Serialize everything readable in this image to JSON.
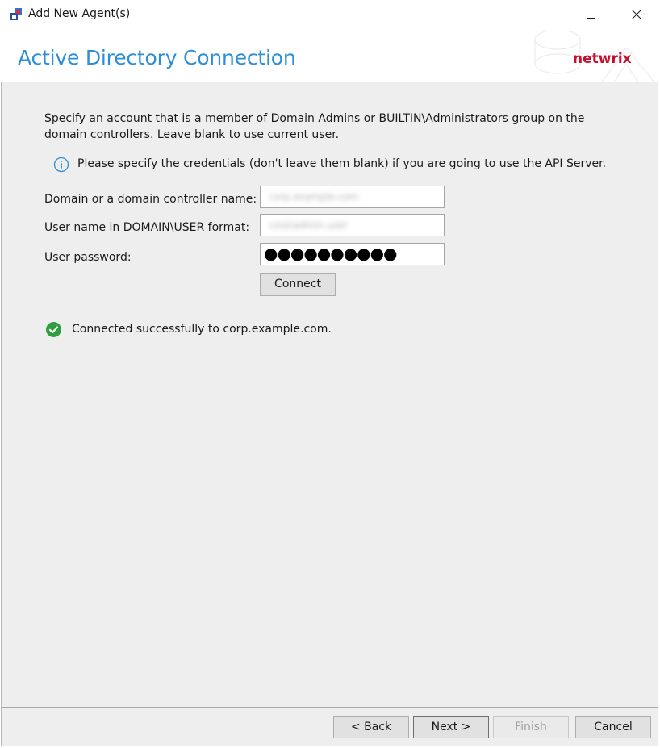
{
  "window": {
    "title": "Add New Agent(s)",
    "controls": [
      "minimize-icon",
      "maximize-icon",
      "close-icon"
    ]
  },
  "header": {
    "title": "Active Directory Connection",
    "logo_text": "netwrix",
    "accent_color": "#2f8fd6",
    "logo_color": "#c8102e"
  },
  "content": {
    "description": "Specify an account that is a member of Domain Admins or BUILTIN\\Administrators group on the domain controllers. Leave blank to use current user.",
    "info": {
      "icon": "info-icon",
      "text": "Please specify the credentials (don't leave them blank) if you are going to use the API Server."
    },
    "fields": {
      "domain": {
        "label": "Domain or a domain controller name:",
        "value": "corp.example.com"
      },
      "username": {
        "label": "User name in DOMAIN\\USER format:",
        "value": "corp\\admin.user"
      },
      "password": {
        "label": "User password:",
        "value": "●●●●●●●●●●"
      }
    },
    "connect_label": "Connect",
    "status": {
      "icon": "checkmark-icon",
      "text": "Connected successfully to corp.example.com.",
      "color": "#2e9e3e"
    }
  },
  "footer": {
    "back": "< Back",
    "next": "Next >",
    "finish": "Finish",
    "cancel": "Cancel"
  }
}
